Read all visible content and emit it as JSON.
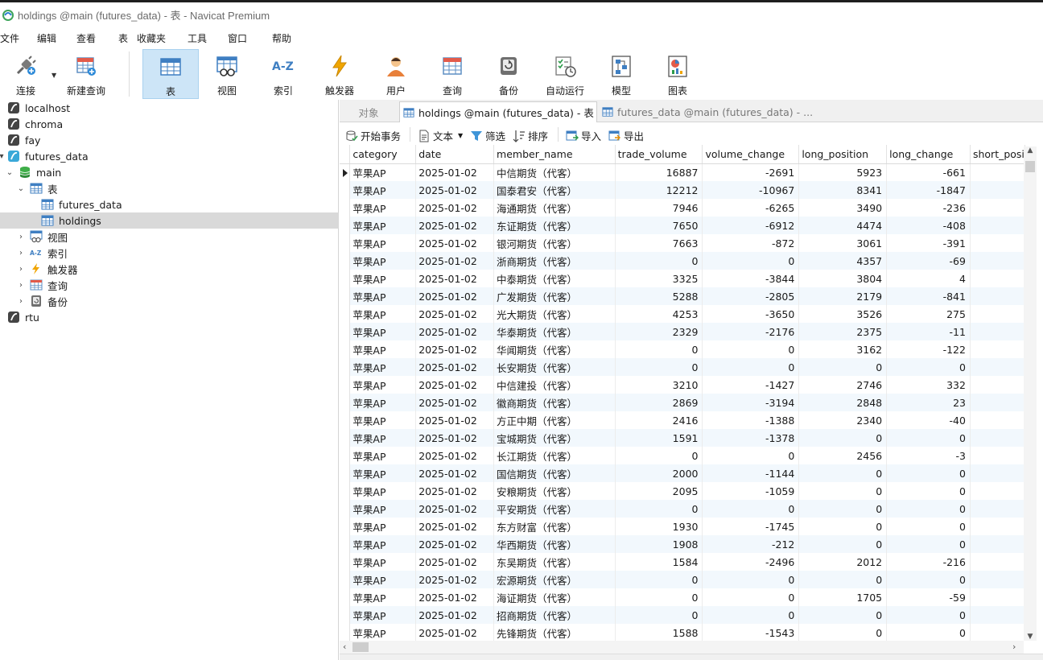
{
  "window": {
    "title": "holdings @main (futures_data) - 表 - Navicat Premium"
  },
  "menu": [
    "文件",
    "编辑",
    "查看",
    "表",
    "收藏夹",
    "工具",
    "窗口",
    "帮助"
  ],
  "toolbar": {
    "buttons": [
      {
        "label": "连接",
        "icon": "connection-icon"
      },
      {
        "label": "新建查询",
        "icon": "new-query-icon"
      },
      {
        "label": "表",
        "icon": "table-icon",
        "active": true
      },
      {
        "label": "视图",
        "icon": "view-icon"
      },
      {
        "label": "索引",
        "icon": "index-icon"
      },
      {
        "label": "触发器",
        "icon": "trigger-icon"
      },
      {
        "label": "用户",
        "icon": "user-icon"
      },
      {
        "label": "查询",
        "icon": "query-icon"
      },
      {
        "label": "备份",
        "icon": "backup-icon"
      },
      {
        "label": "自动运行",
        "icon": "automation-icon"
      },
      {
        "label": "模型",
        "icon": "model-icon"
      },
      {
        "label": "图表",
        "icon": "chart-icon"
      }
    ]
  },
  "sidebar": {
    "items": [
      {
        "label": "localhost",
        "icon": "sqlite-connection-icon"
      },
      {
        "label": "chroma",
        "icon": "sqlite-connection-icon"
      },
      {
        "label": "fay",
        "icon": "sqlite-connection-icon"
      },
      {
        "label": "futures_data",
        "icon": "sqlite-connection-open-icon"
      },
      {
        "label": "main",
        "icon": "database-icon"
      },
      {
        "label": "表",
        "icon": "table-folder-icon"
      },
      {
        "label": "futures_data",
        "icon": "table-icon"
      },
      {
        "label": "holdings",
        "icon": "table-icon",
        "selected": true
      },
      {
        "label": "视图",
        "icon": "view-icon"
      },
      {
        "label": "索引",
        "icon": "index-icon"
      },
      {
        "label": "触发器",
        "icon": "trigger-icon"
      },
      {
        "label": "查询",
        "icon": "query-icon"
      },
      {
        "label": "备份",
        "icon": "backup-icon"
      },
      {
        "label": "rtu",
        "icon": "sqlite-connection-icon"
      }
    ]
  },
  "tabs": {
    "objects": "对象",
    "active": "holdings @main (futures_data) - 表",
    "inactive": "futures_data @main (futures_data) - ..."
  },
  "subtoolbar": {
    "begin_transaction": "开始事务",
    "text": "文本",
    "filter": "筛选",
    "sort": "排序",
    "import": "导入",
    "export": "导出"
  },
  "grid": {
    "columns": [
      "category",
      "date",
      "member_name",
      "trade_volume",
      "volume_change",
      "long_position",
      "long_change",
      "short_posi"
    ],
    "rows": [
      [
        "苹果AP",
        "2025-01-02",
        "中信期货（代客）",
        "16887",
        "-2691",
        "5923",
        "-661",
        ""
      ],
      [
        "苹果AP",
        "2025-01-02",
        "国泰君安（代客）",
        "12212",
        "-10967",
        "8341",
        "-1847",
        ""
      ],
      [
        "苹果AP",
        "2025-01-02",
        "海通期货（代客）",
        "7946",
        "-6265",
        "3490",
        "-236",
        ""
      ],
      [
        "苹果AP",
        "2025-01-02",
        "东证期货（代客）",
        "7650",
        "-6912",
        "4474",
        "-408",
        ""
      ],
      [
        "苹果AP",
        "2025-01-02",
        "银河期货（代客）",
        "7663",
        "-872",
        "3061",
        "-391",
        ""
      ],
      [
        "苹果AP",
        "2025-01-02",
        "浙商期货（代客）",
        "0",
        "0",
        "4357",
        "-69",
        ""
      ],
      [
        "苹果AP",
        "2025-01-02",
        "中泰期货（代客）",
        "3325",
        "-3844",
        "3804",
        "4",
        ""
      ],
      [
        "苹果AP",
        "2025-01-02",
        "广发期货（代客）",
        "5288",
        "-2805",
        "2179",
        "-841",
        ""
      ],
      [
        "苹果AP",
        "2025-01-02",
        "光大期货（代客）",
        "4253",
        "-3650",
        "3526",
        "275",
        ""
      ],
      [
        "苹果AP",
        "2025-01-02",
        "华泰期货（代客）",
        "2329",
        "-2176",
        "2375",
        "-11",
        ""
      ],
      [
        "苹果AP",
        "2025-01-02",
        "华闻期货（代客）",
        "0",
        "0",
        "3162",
        "-122",
        ""
      ],
      [
        "苹果AP",
        "2025-01-02",
        "长安期货（代客）",
        "0",
        "0",
        "0",
        "0",
        ""
      ],
      [
        "苹果AP",
        "2025-01-02",
        "中信建投（代客）",
        "3210",
        "-1427",
        "2746",
        "332",
        ""
      ],
      [
        "苹果AP",
        "2025-01-02",
        "徽商期货（代客）",
        "2869",
        "-3194",
        "2848",
        "23",
        ""
      ],
      [
        "苹果AP",
        "2025-01-02",
        "方正中期（代客）",
        "2416",
        "-1388",
        "2340",
        "-40",
        ""
      ],
      [
        "苹果AP",
        "2025-01-02",
        "宝城期货（代客）",
        "1591",
        "-1378",
        "0",
        "0",
        ""
      ],
      [
        "苹果AP",
        "2025-01-02",
        "长江期货（代客）",
        "0",
        "0",
        "2456",
        "-3",
        ""
      ],
      [
        "苹果AP",
        "2025-01-02",
        "国信期货（代客）",
        "2000",
        "-1144",
        "0",
        "0",
        ""
      ],
      [
        "苹果AP",
        "2025-01-02",
        "安粮期货（代客）",
        "2095",
        "-1059",
        "0",
        "0",
        ""
      ],
      [
        "苹果AP",
        "2025-01-02",
        "平安期货（代客）",
        "0",
        "0",
        "0",
        "0",
        ""
      ],
      [
        "苹果AP",
        "2025-01-02",
        "东方财富（代客）",
        "1930",
        "-1745",
        "0",
        "0",
        ""
      ],
      [
        "苹果AP",
        "2025-01-02",
        "华西期货（代客）",
        "1908",
        "-212",
        "0",
        "0",
        ""
      ],
      [
        "苹果AP",
        "2025-01-02",
        "东吴期货（代客）",
        "1584",
        "-2496",
        "2012",
        "-216",
        ""
      ],
      [
        "苹果AP",
        "2025-01-02",
        "宏源期货（代客）",
        "0",
        "0",
        "0",
        "0",
        ""
      ],
      [
        "苹果AP",
        "2025-01-02",
        "海证期货（代客）",
        "0",
        "0",
        "1705",
        "-59",
        ""
      ],
      [
        "苹果AP",
        "2025-01-02",
        "招商期货（代客）",
        "0",
        "0",
        "0",
        "0",
        ""
      ],
      [
        "苹果AP",
        "2025-01-02",
        "先锋期货（代客）",
        "1588",
        "-1543",
        "0",
        "0",
        ""
      ]
    ]
  },
  "colors": {
    "selection": "#cde5f7",
    "tree_selected": "#d9d9d9",
    "row_alt": "#f2f8fd"
  }
}
